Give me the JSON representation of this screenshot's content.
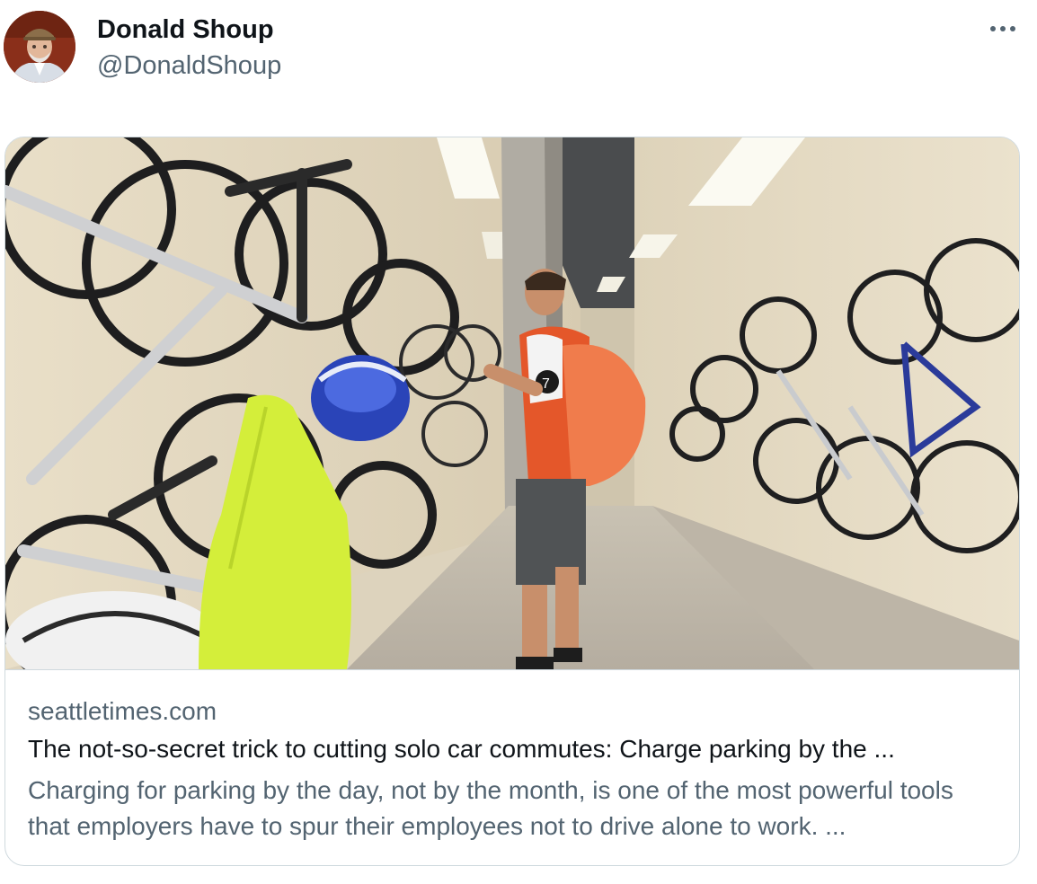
{
  "tweet": {
    "author": {
      "display_name": "Donald Shoup",
      "handle": "@DonaldShoup",
      "avatar_icon": "profile-photo"
    },
    "more_icon": "more-dots-icon",
    "link_card": {
      "domain": "seattletimes.com",
      "title": "The not-so-secret trick to cutting solo car commutes: Charge parking by the ...",
      "description": "Charging for parking by the day, not by the month, is one of the most powerful tools that employers have to spur their employees not to drive alone to work. ..."
    }
  },
  "colors": {
    "primary_text": "#0f1419",
    "secondary_text": "#536471",
    "border": "#cfd9de"
  }
}
